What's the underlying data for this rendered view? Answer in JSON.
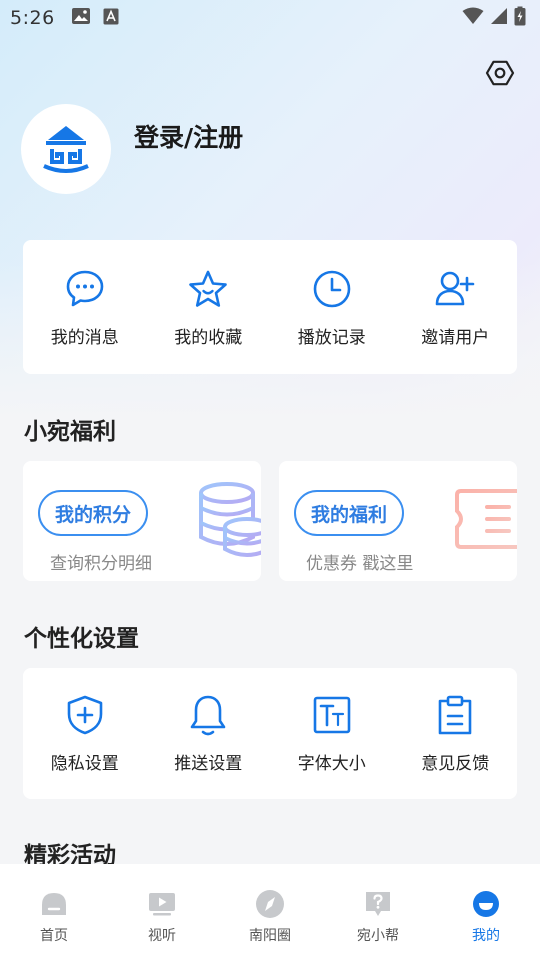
{
  "status": {
    "time": "5:26"
  },
  "profile": {
    "login_label": "登录/注册"
  },
  "quick_actions": [
    {
      "label": "我的消息",
      "icon": "message-icon"
    },
    {
      "label": "我的收藏",
      "icon": "star-icon"
    },
    {
      "label": "播放记录",
      "icon": "clock-icon"
    },
    {
      "label": "邀请用户",
      "icon": "invite-user-icon"
    }
  ],
  "welfare": {
    "title": "小宛福利",
    "points": {
      "button": "我的积分",
      "subtitle": "查询积分明细"
    },
    "benefits": {
      "button": "我的福利",
      "subtitle": "优惠券  戳这里"
    }
  },
  "personal_settings": {
    "title": "个性化设置",
    "items": [
      {
        "label": "隐私设置",
        "icon": "shield-icon"
      },
      {
        "label": "推送设置",
        "icon": "bell-icon"
      },
      {
        "label": "字体大小",
        "icon": "font-size-icon"
      },
      {
        "label": "意见反馈",
        "icon": "clipboard-icon"
      }
    ]
  },
  "activities": {
    "title": "精彩活动"
  },
  "tabs": [
    {
      "label": "首页",
      "icon": "home-icon",
      "active": false
    },
    {
      "label": "视听",
      "icon": "play-icon",
      "active": false
    },
    {
      "label": "南阳圈",
      "icon": "compass-icon",
      "active": false
    },
    {
      "label": "宛小帮",
      "icon": "help-icon",
      "active": false
    },
    {
      "label": "我的",
      "icon": "profile-icon",
      "active": true
    }
  ],
  "colors": {
    "accent": "#1677e6",
    "pill_border": "#3b8ff0",
    "tab_inactive": "#c7c9cc"
  }
}
